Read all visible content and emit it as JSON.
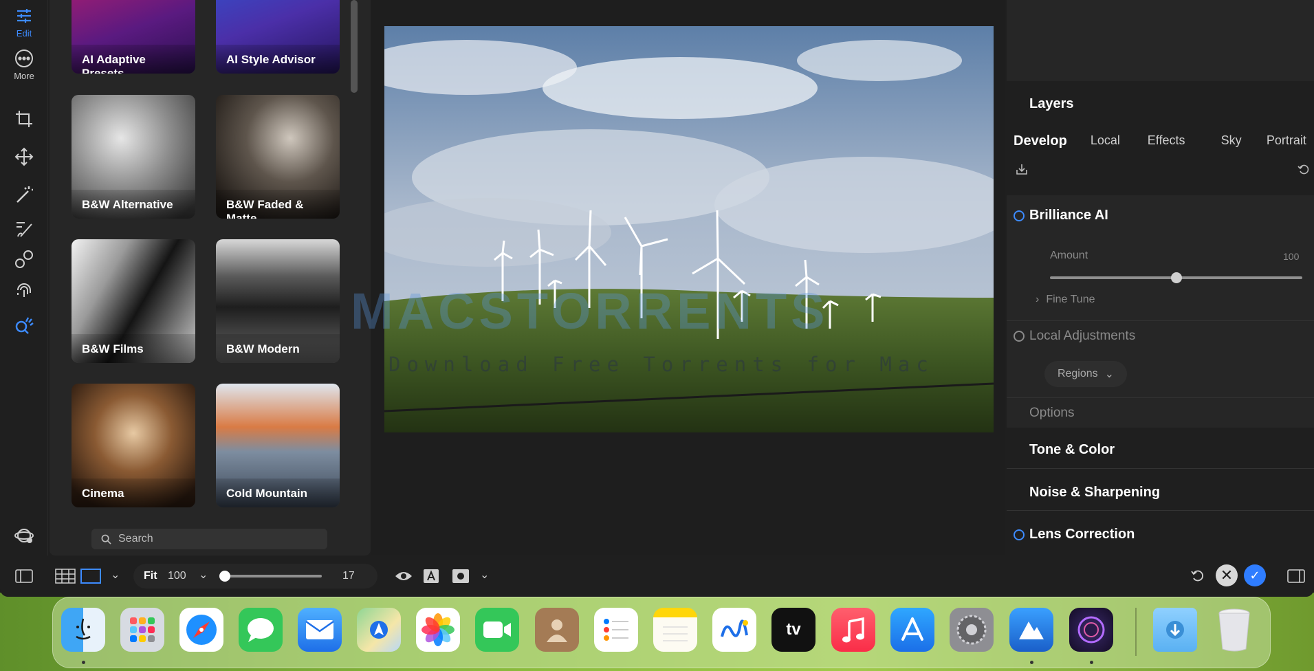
{
  "tool_rail": {
    "edit_label": "Edit",
    "more_label": "More"
  },
  "presets": [
    {
      "label": "AI Adaptive Presets"
    },
    {
      "label": "AI Style Advisor"
    },
    {
      "label": "B&W Alternative"
    },
    {
      "label": "B&W Faded & Matte"
    },
    {
      "label": "B&W Films"
    },
    {
      "label": "B&W Modern"
    },
    {
      "label": "Cinema"
    },
    {
      "label": "Cold Mountain"
    }
  ],
  "search": {
    "placeholder": "Search"
  },
  "watermark": {
    "brand": "MACSTORRENTS",
    "tagline": "Download Free Torrents for Mac"
  },
  "right_panel": {
    "layers_title": "Layers",
    "tabs": [
      {
        "label": "Develop",
        "active": true
      },
      {
        "label": "Local"
      },
      {
        "label": "Effects"
      },
      {
        "label": "Sky"
      },
      {
        "label": "Portrait"
      }
    ],
    "brilliance": {
      "title": "Brilliance AI",
      "amount_label": "Amount",
      "amount_value": "100",
      "amount_fraction": 0.5,
      "fine_tune_label": "Fine Tune"
    },
    "local_adjustments": {
      "title": "Local Adjustments",
      "regions_label": "Regions"
    },
    "options_label": "Options",
    "sections": {
      "tone_color": "Tone & Color",
      "noise_sharpening": "Noise & Sharpening",
      "lens_correction": "Lens Correction"
    }
  },
  "bottom_bar": {
    "fit_label": "Fit",
    "zoom_value": "100",
    "size_value": "17",
    "size_fraction": 0.0
  },
  "dock": {
    "apps": [
      "Finder",
      "Launchpad",
      "Safari",
      "Messages",
      "Mail",
      "Maps",
      "Photos",
      "FaceTime",
      "Contacts",
      "Reminders",
      "Notes",
      "Freeform",
      "TV",
      "Music",
      "App Store",
      "System Settings",
      "Luminar",
      "Capture One",
      "Downloads",
      "Trash"
    ],
    "tv_label": "tv"
  },
  "colors": {
    "accent": "#3d8bff",
    "panel": "#262626",
    "background": "#1f1f1f"
  }
}
